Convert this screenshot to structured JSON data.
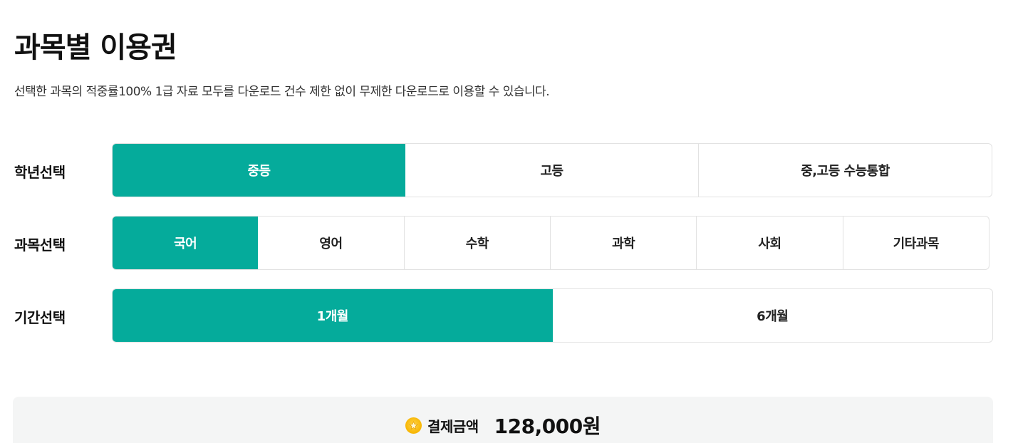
{
  "title": "과목별 이용권",
  "description": "선택한 과목의 적중률100% 1급 자료 모두를 다운로드 건수 제한 없이 무제한 다운로드로 이용할 수 있습니다.",
  "grade": {
    "label": "학년선택",
    "options": [
      {
        "label": "중등",
        "active": true
      },
      {
        "label": "고등",
        "active": false
      },
      {
        "label": "중,고등 수능통합",
        "active": false
      }
    ]
  },
  "subject": {
    "label": "과목선택",
    "options": [
      {
        "label": "국어",
        "active": true
      },
      {
        "label": "영어",
        "active": false
      },
      {
        "label": "수학",
        "active": false
      },
      {
        "label": "과학",
        "active": false
      },
      {
        "label": "사회",
        "active": false
      },
      {
        "label": "기타과목",
        "active": false
      }
    ]
  },
  "period": {
    "label": "기간선택",
    "options": [
      {
        "label": "1개월",
        "active": true
      },
      {
        "label": "6개월",
        "active": false
      }
    ]
  },
  "payment": {
    "icon": "coin-icon",
    "label": "결제금액",
    "amount": "128,000원"
  },
  "colors": {
    "accent": "#05ab9b",
    "coin": "#f7b500"
  }
}
